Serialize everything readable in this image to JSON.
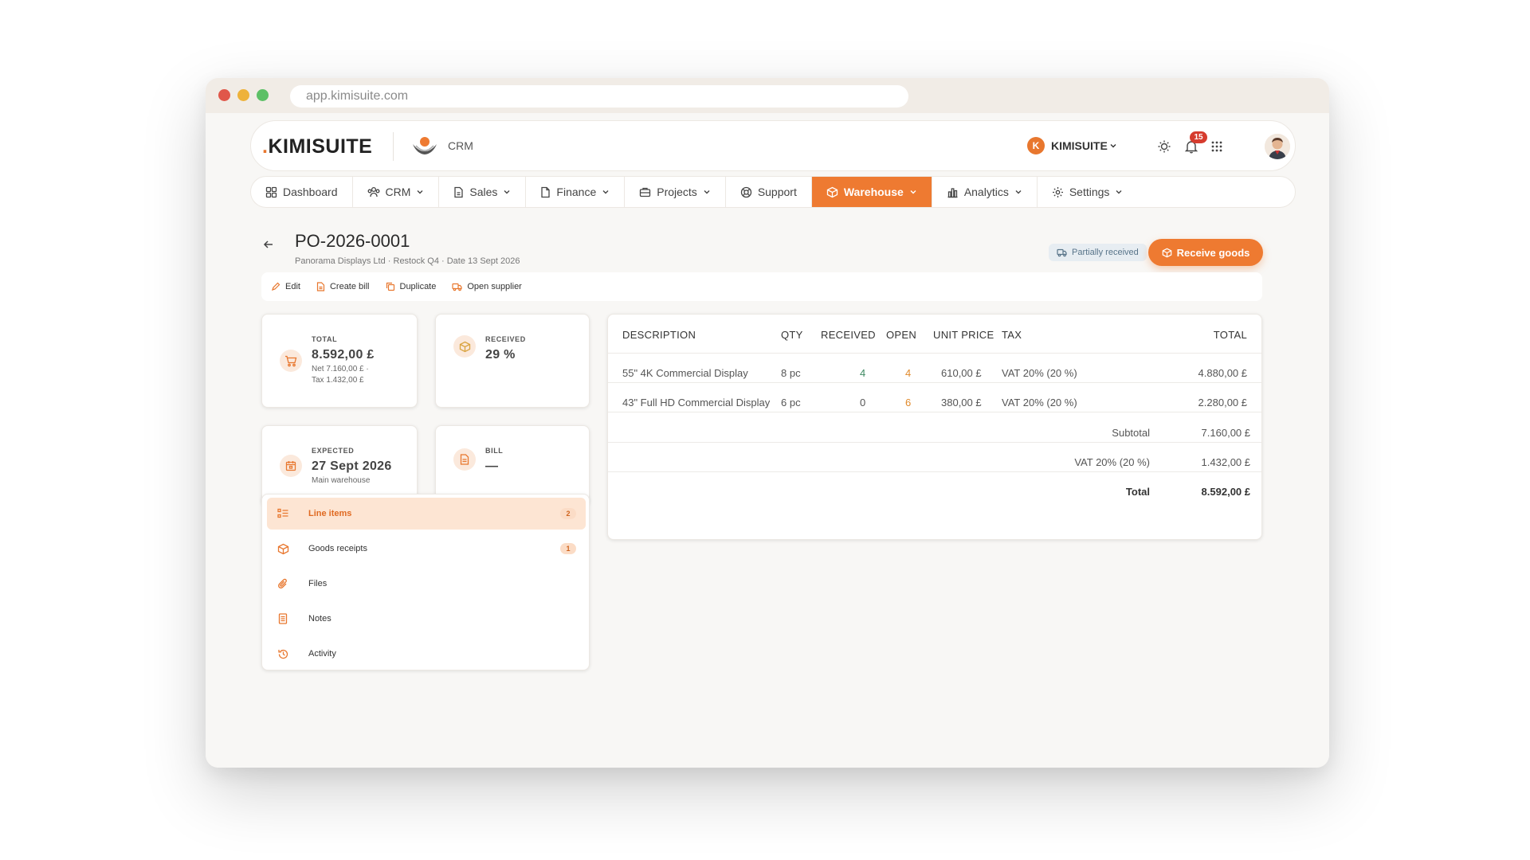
{
  "browser": {
    "url": "app.kimisuite.com"
  },
  "topbar": {
    "logo_dot": ".",
    "logo_text": "KIMISUITE",
    "module": "CRM",
    "workspace_initial": "K",
    "workspace_name": "KIMISUITE",
    "notification_count": "15"
  },
  "nav": {
    "items": [
      {
        "label": "Dashboard",
        "icon": "grid-icon"
      },
      {
        "label": "CRM",
        "icon": "users-icon"
      },
      {
        "label": "Sales",
        "icon": "document-icon"
      },
      {
        "label": "Finance",
        "icon": "file-icon"
      },
      {
        "label": "Projects",
        "icon": "briefcase-icon"
      },
      {
        "label": "Support",
        "icon": "lifebuoy-icon"
      },
      {
        "label": "Warehouse",
        "icon": "box-icon",
        "active": true
      },
      {
        "label": "Analytics",
        "icon": "bar-chart-icon"
      },
      {
        "label": "Settings",
        "icon": "gear-icon"
      }
    ]
  },
  "page": {
    "title": "PO-2026-0001",
    "subtitle": "Panorama Displays Ltd · Restock Q4 · Date 13 Sept 2026",
    "status": "Partially received",
    "primary_action": "Receive goods",
    "actions": [
      "Edit",
      "Create bill",
      "Duplicate",
      "Open supplier"
    ]
  },
  "stats": {
    "total": {
      "label": "TOTAL",
      "value": "8.592,00 £",
      "note1": "Net 7.160,00 £ ·",
      "note2": "Tax 1.432,00 £"
    },
    "received": {
      "label": "RECEIVED",
      "value": "29 %"
    },
    "expected": {
      "label": "EXPECTED",
      "value": "27 Sept 2026",
      "note": "Main warehouse"
    },
    "bill": {
      "label": "BILL",
      "value": "—"
    }
  },
  "side_tabs": [
    {
      "label": "Line items",
      "count": "2",
      "active": true
    },
    {
      "label": "Goods receipts",
      "count": "1"
    },
    {
      "label": "Files"
    },
    {
      "label": "Notes"
    },
    {
      "label": "Activity"
    }
  ],
  "table": {
    "headers": [
      "DESCRIPTION",
      "QTY",
      "RECEIVED",
      "OPEN",
      "UNIT PRICE",
      "TAX",
      "TOTAL"
    ],
    "rows": [
      {
        "description": "55\" 4K Commercial Display",
        "qty": "8 pc",
        "received": "4",
        "open": "4",
        "unit_price": "610,00 £",
        "tax": "VAT 20% (20 %)",
        "total": "4.880,00 £"
      },
      {
        "description": "43\" Full HD Commercial Display",
        "qty": "6 pc",
        "received": "0",
        "open": "6",
        "unit_price": "380,00 £",
        "tax": "VAT 20% (20 %)",
        "total": "2.280,00 £"
      }
    ],
    "summary": {
      "subtotal_label": "Subtotal",
      "subtotal": "7.160,00 £",
      "tax_label": "VAT 20% (20 %)",
      "tax": "1.432,00 £",
      "total_label": "Total",
      "total": "8.592,00 £"
    }
  },
  "colors": {
    "accent": "#ee7a31",
    "status_bg": "#e7edf2",
    "received_green": "#3f8a63",
    "open_orange": "#e08a2c"
  }
}
